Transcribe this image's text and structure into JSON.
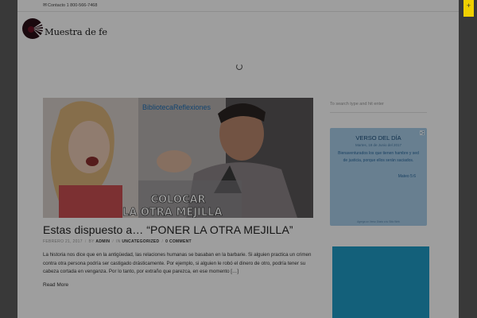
{
  "topbar": {
    "contact": "Contacto  1 800-566-7468"
  },
  "header": {
    "logo_text": "Muestra de fe"
  },
  "hero": {
    "watermark": "BibliotecaReflexiones",
    "caption_line1": "COLOCAR",
    "caption_line2": "LA OTRA MEJILLA"
  },
  "post": {
    "title": "Estas dispuesto a… “PONER LA OTRA MEJILLA”",
    "date": "FEBRERO 21, 2017",
    "by_prefix": "BY",
    "author": "ADMIN",
    "in_prefix": "IN",
    "category": "UNCATEGORIZED",
    "comments": "0 COMMENT",
    "excerpt": "La historia nos dice que en la antigüedad, las relaciones humanas se basaban en la barbarie. Si alguien practica un crimen contra otra persona podría ser castigado drásticamente. Por ejemplo, si alguien le robó el dinero de otro, podría tener su cabeza cortada en venganza. Por lo tanto, por extraño que parezca, en ese momento […]",
    "read_more": "Read More"
  },
  "sidebar": {
    "search_placeholder": "To search type and hit enter",
    "verse": {
      "title": "VERSO DEL DÍA",
      "date": "Martes, 18 de Junio del 2017",
      "text": "Bienaventurados los que tienen hambre y sed de justicia, porque ellos serán saciados.",
      "reference": "Mateo 5:6",
      "footer": "Agrega un Verso Diario a tu Sitio Web"
    }
  },
  "colors": {
    "verse_bg": "#a8cde8",
    "teal_box": "#1f9bc6",
    "corner_tab": "#f0d000"
  },
  "icons": {
    "contact": "envelope-icon",
    "loading": "spinner-icon",
    "verse_share": "share-icon",
    "corner": "plus-icon"
  }
}
